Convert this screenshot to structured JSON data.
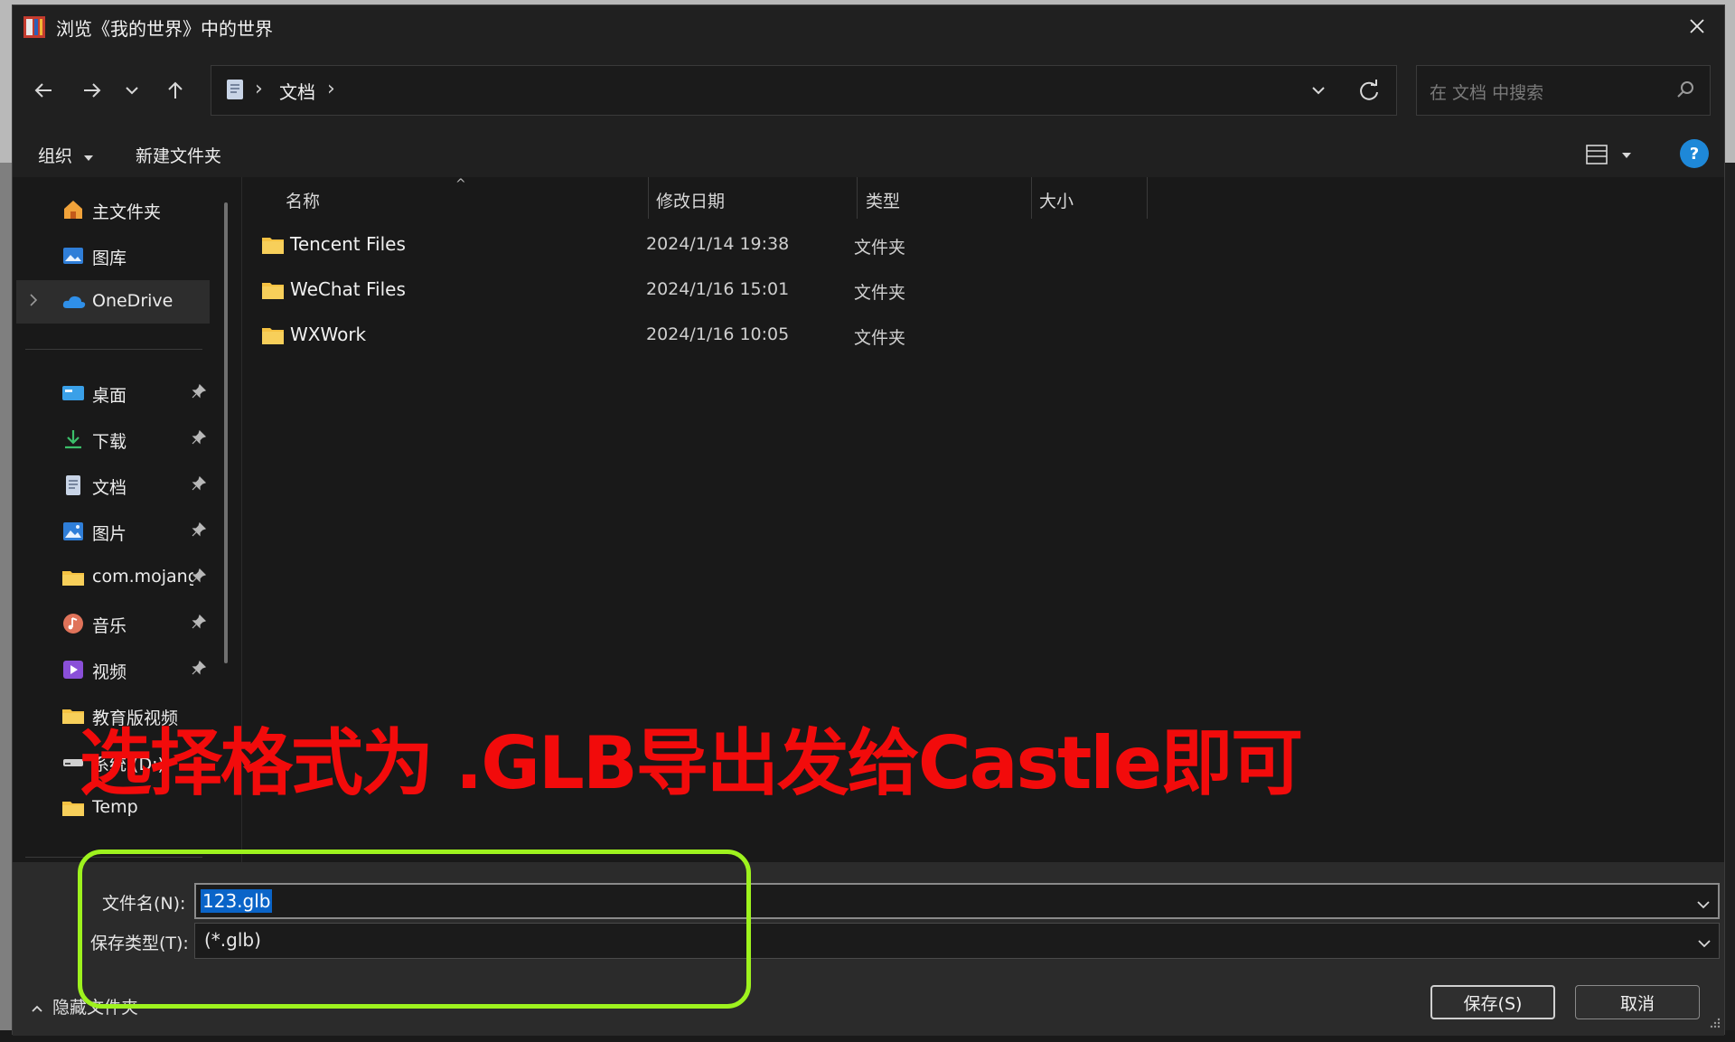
{
  "window": {
    "title": "浏览《我的世界》中的世界"
  },
  "address_bar": {
    "location": "文档",
    "search_placeholder": "在 文档 中搜索"
  },
  "command_bar": {
    "organize": "组织",
    "new_folder": "新建文件夹"
  },
  "nav_pane": {
    "top_items": [
      {
        "label": "主文件夹",
        "icon": "home-icon"
      },
      {
        "label": "图库",
        "icon": "gallery-icon"
      },
      {
        "label": "OneDrive",
        "icon": "onedrive-cloud-icon"
      }
    ],
    "pinned_items": [
      {
        "label": "桌面",
        "icon": "desktop-icon"
      },
      {
        "label": "下载",
        "icon": "download-icon"
      },
      {
        "label": "文档",
        "icon": "document-icon"
      },
      {
        "label": "图片",
        "icon": "pictures-icon"
      },
      {
        "label": "com.mojang",
        "icon": "folder-icon"
      },
      {
        "label": "音乐",
        "icon": "music-icon"
      },
      {
        "label": "视频",
        "icon": "video-icon"
      }
    ],
    "other_items": [
      {
        "label": "教育版视频",
        "icon": "folder-icon"
      },
      {
        "label": "系统 (D:)",
        "icon": "drive-icon"
      },
      {
        "label": "Temp",
        "icon": "folder-icon"
      }
    ]
  },
  "file_list": {
    "columns": [
      "名称",
      "修改日期",
      "类型",
      "大小"
    ],
    "rows": [
      {
        "name": "Tencent Files",
        "date": "2024/1/14 19:38",
        "type": "文件夹",
        "size": ""
      },
      {
        "name": "WeChat Files",
        "date": "2024/1/16 15:01",
        "type": "文件夹",
        "size": ""
      },
      {
        "name": "WXWork",
        "date": "2024/1/16 10:05",
        "type": "文件夹",
        "size": ""
      }
    ]
  },
  "save_panel": {
    "filename_label": "文件名(N):",
    "filename_value": "123.glb",
    "filetype_label": "保存类型(T):",
    "filetype_value": "(*.glb)",
    "hide_folders": "隐藏文件夹",
    "save_button": "保存(S)",
    "cancel_button": "取消"
  },
  "annotation": {
    "text": "选择格式为 .GLB导出发给Castle即可",
    "text_color": "#f20b0b",
    "box_color": "#9ef21e"
  },
  "colors": {
    "dialog_bg": "#191919",
    "accent": "#0a64c8",
    "folder": "#f5c242"
  }
}
